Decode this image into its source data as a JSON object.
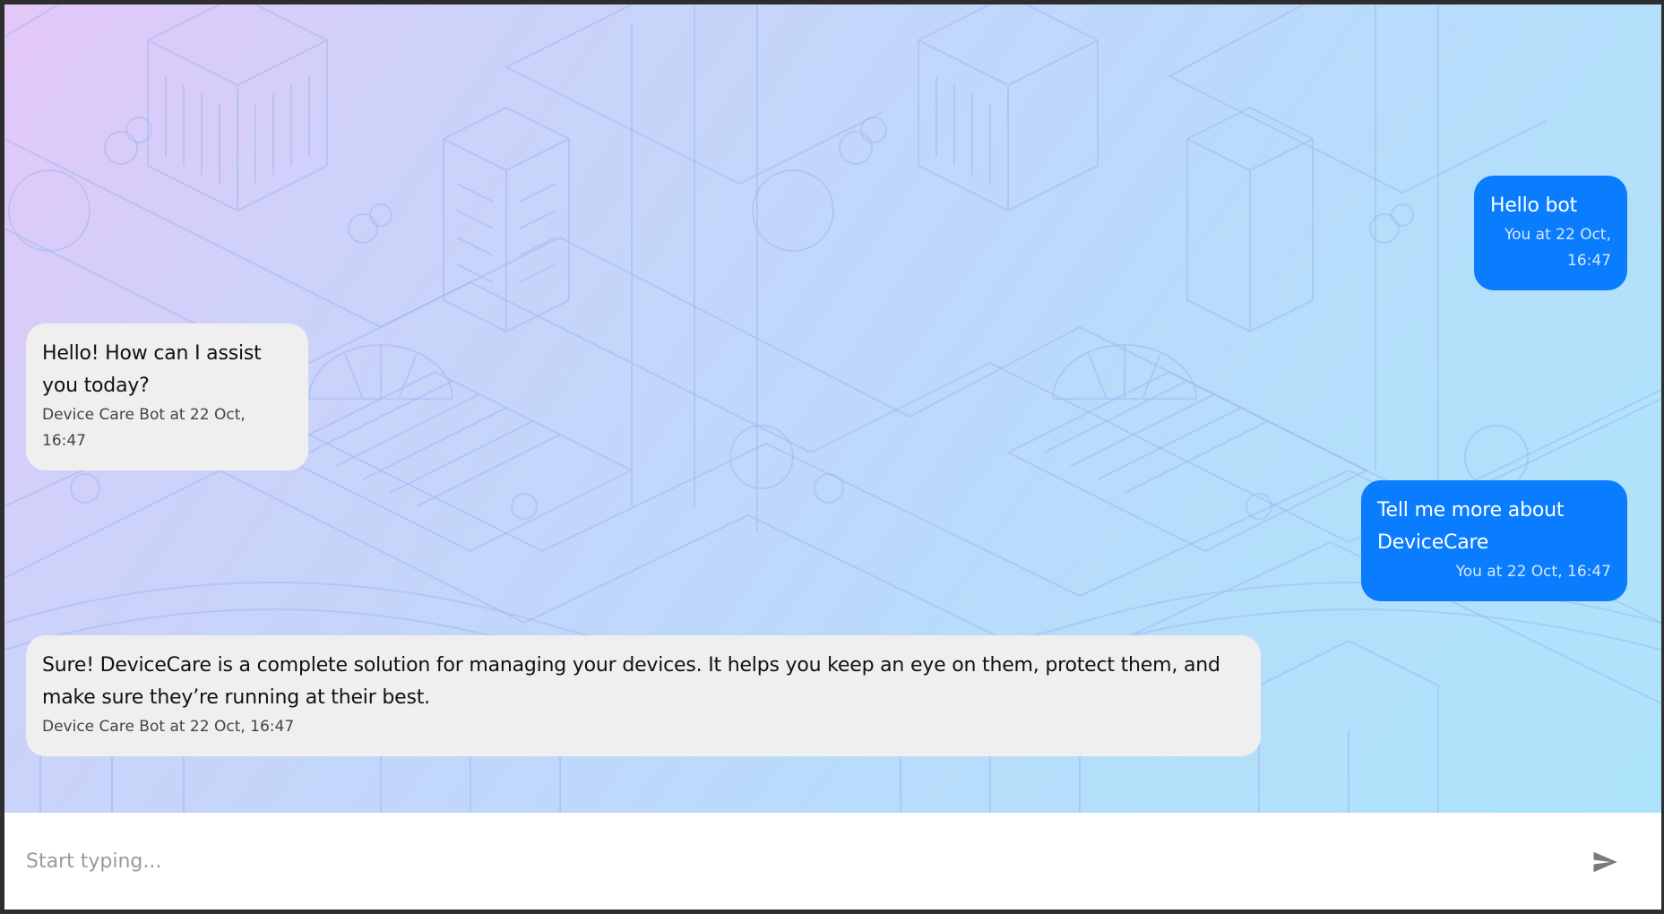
{
  "chat": {
    "messages": [
      {
        "sender": "user",
        "text": "Hello bot",
        "meta": "You at 22 Oct, 16:47"
      },
      {
        "sender": "bot",
        "text": "Hello! How can I assist you today?",
        "meta": "Device Care Bot at 22 Oct, 16:47"
      },
      {
        "sender": "user",
        "text": "Tell me more about DeviceCare",
        "meta": "You at 22 Oct, 16:47"
      },
      {
        "sender": "bot",
        "text": "Sure! DeviceCare is a complete solution for managing your devices. It helps you keep an eye on them, protect them, and make sure they’re running at their best.",
        "meta": "Device Care Bot at 22 Oct, 16:47"
      }
    ]
  },
  "composer": {
    "placeholder": "Start typing...",
    "value": "",
    "send_icon": "send-icon"
  },
  "colors": {
    "user_bubble": "#0a7cfe",
    "bot_bubble": "#efefef",
    "background_gradient_start": "#e4c7f7",
    "background_gradient_end": "#aee4fb"
  }
}
